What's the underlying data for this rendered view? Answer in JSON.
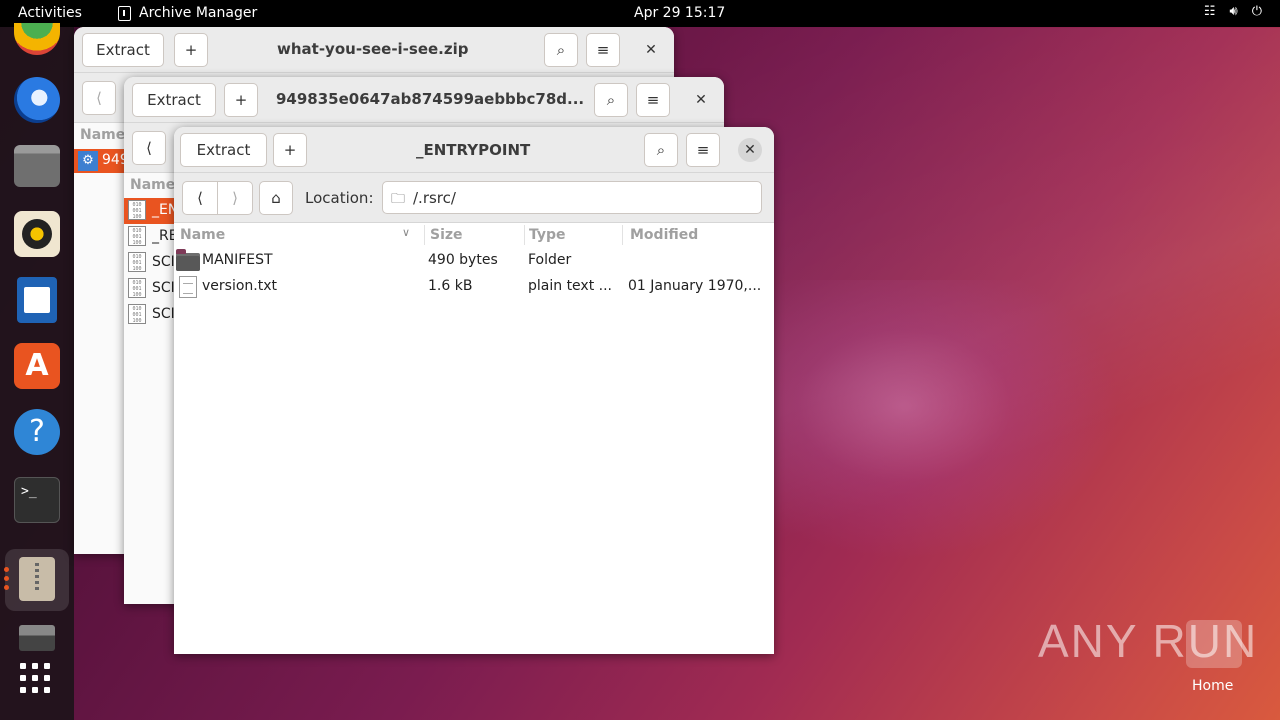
{
  "topbar": {
    "activities": "Activities",
    "app_name": "Archive Manager",
    "clock": "Apr 29  15:17",
    "tray_icons": [
      "network-icon",
      "volume-icon",
      "power-icon"
    ]
  },
  "dock": {
    "items": [
      "chrome-icon",
      "thunderbird-icon",
      "files-icon",
      "rhythmbox-icon",
      "writer-icon",
      "app-center-icon",
      "help-icon",
      "terminal-icon",
      "archive-manager-icon",
      "disk-icon",
      "show-apps-icon"
    ]
  },
  "win1": {
    "extract": "Extract",
    "title": "what-you-see-i-see.zip",
    "col_name": "Name",
    "row_label": "949"
  },
  "win2": {
    "extract": "Extract",
    "title": "949835e0647ab874599aebbbc78d...",
    "col_name": "Name",
    "rows": [
      "_EN",
      "_RE",
      "SCI",
      "SCI",
      "SCI"
    ]
  },
  "win3": {
    "extract": "Extract",
    "title": "_ENTRYPOINT",
    "location_label": "Location:",
    "location_value": "/.rsrc/",
    "columns": {
      "name": "Name",
      "size": "Size",
      "type": "Type",
      "modified": "Modified"
    },
    "rows": [
      {
        "name": "MANIFEST",
        "size": "490 bytes",
        "type": "Folder",
        "modified": ""
      },
      {
        "name": "version.txt",
        "size": "1.6 kB",
        "type": "plain text ...",
        "modified": "01 January 1970,..."
      }
    ]
  },
  "desktop": {
    "watermark": "ANY RUN",
    "home_label": "Home"
  }
}
